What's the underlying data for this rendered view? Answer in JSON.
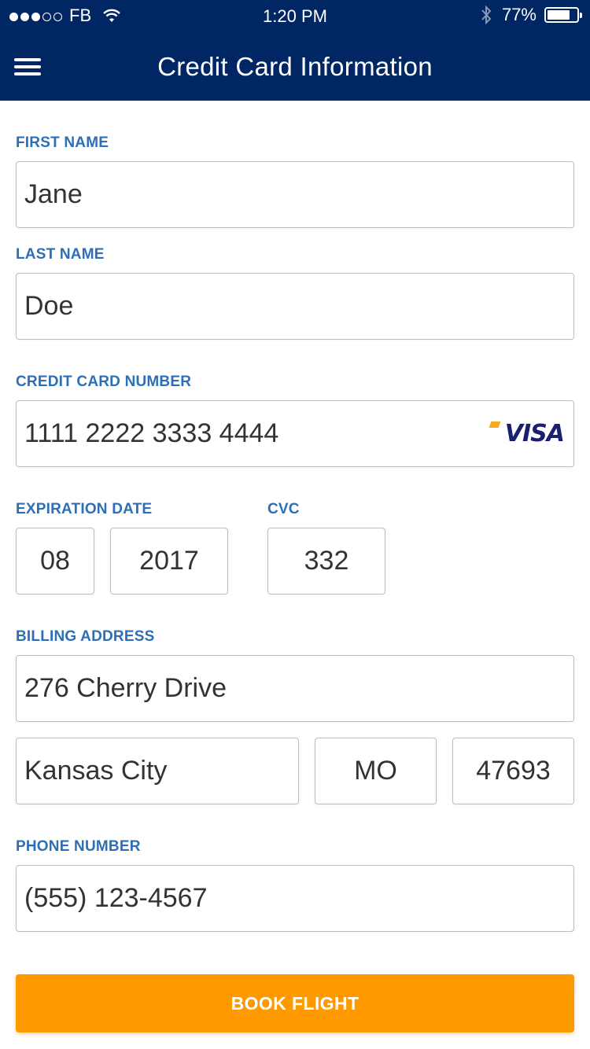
{
  "status_bar": {
    "carrier": "FB",
    "time": "1:20 PM",
    "battery": "77%",
    "battery_level": 0.77
  },
  "header": {
    "title": "Credit Card Information"
  },
  "form": {
    "first_name": {
      "label": "FIRST NAME",
      "value": "Jane"
    },
    "last_name": {
      "label": "LAST NAME",
      "value": "Doe"
    },
    "card_number": {
      "label": "CREDIT CARD NUMBER",
      "value": "1111 2222 3333 4444",
      "brand": "VISA"
    },
    "expiration": {
      "label": "EXPIRATION DATE",
      "month": "08",
      "year": "2017"
    },
    "cvc": {
      "label": "CVC",
      "value": "332"
    },
    "billing": {
      "label": "BILLING ADDRESS",
      "street": "276 Cherry Drive",
      "city": "Kansas City",
      "state": "MO",
      "zip": "47693"
    },
    "phone": {
      "label": "PHONE NUMBER",
      "value": "(555) 123-4567"
    }
  },
  "actions": {
    "book_label": "BOOK FLIGHT"
  },
  "colors": {
    "header_bg": "#002663",
    "label": "#2d6fb6",
    "button": "#ff9900",
    "visa": "#1a1f71"
  },
  "icons": [
    "signal-dots-icon",
    "wifi-icon",
    "bluetooth-icon",
    "battery-icon",
    "menu-icon"
  ]
}
